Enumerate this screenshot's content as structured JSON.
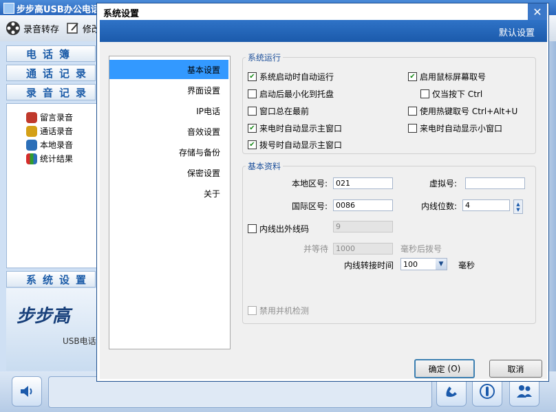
{
  "app": {
    "title": "步步高USB办公电话",
    "toolbar": {
      "record_save": "录音转存",
      "edit": "修改"
    },
    "nav": {
      "phonebook": "电话簿",
      "call_log": "通话记录",
      "recordings": "录音记录",
      "settings": "系统设置"
    },
    "tree": [
      "留言录音",
      "通话录音",
      "本地录音",
      "统计结果"
    ],
    "brand": {
      "logo": "步步高",
      "subtitle": "USB电话"
    }
  },
  "dialog": {
    "title": "系统设置",
    "close": "✕",
    "header_label": "默认设置",
    "categories": [
      "基本设置",
      "界面设置",
      "IP电话",
      "音效设置",
      "存储与备份",
      "保密设置",
      "关于"
    ],
    "selected_category": "基本设置",
    "system_run": {
      "legend": "系统运行",
      "items": [
        {
          "label": "系统启动时自动运行",
          "checked": true
        },
        {
          "label": "启动后最小化到托盘",
          "checked": false
        },
        {
          "label": "窗口总在最前",
          "checked": false
        },
        {
          "label": "来电时自动显示主窗口",
          "checked": true
        },
        {
          "label": "拨号时自动显示主窗口",
          "checked": true
        },
        {
          "label": "启用鼠标屏幕取号",
          "checked": true
        },
        {
          "label": "仅当按下 Ctrl",
          "checked": false
        },
        {
          "label": "使用热键取号 Ctrl+Alt+U",
          "checked": false
        },
        {
          "label": "来电时自动显示小窗口",
          "checked": false
        }
      ]
    },
    "basic_info": {
      "legend": "基本资料",
      "local_area_label": "本地区号:",
      "local_area_value": "021",
      "virtual_label": "虚拟号:",
      "virtual_value": "",
      "country_label": "国际区号:",
      "country_value": "0086",
      "ext_digits_label": "内线位数:",
      "ext_digits_value": "4",
      "outline_label": "内线出外线码",
      "outline_checked": false,
      "outline_value": "9",
      "wait_label": "并等待",
      "wait_value": "1000",
      "wait_unit": "毫秒后拨号",
      "transfer_label": "内线转接时间",
      "transfer_value": "100",
      "transfer_unit": "毫秒",
      "parallel_label": "禁用并机检测",
      "parallel_checked": false
    },
    "ok": "确定",
    "ok_key": "(O)",
    "cancel": "取消"
  }
}
